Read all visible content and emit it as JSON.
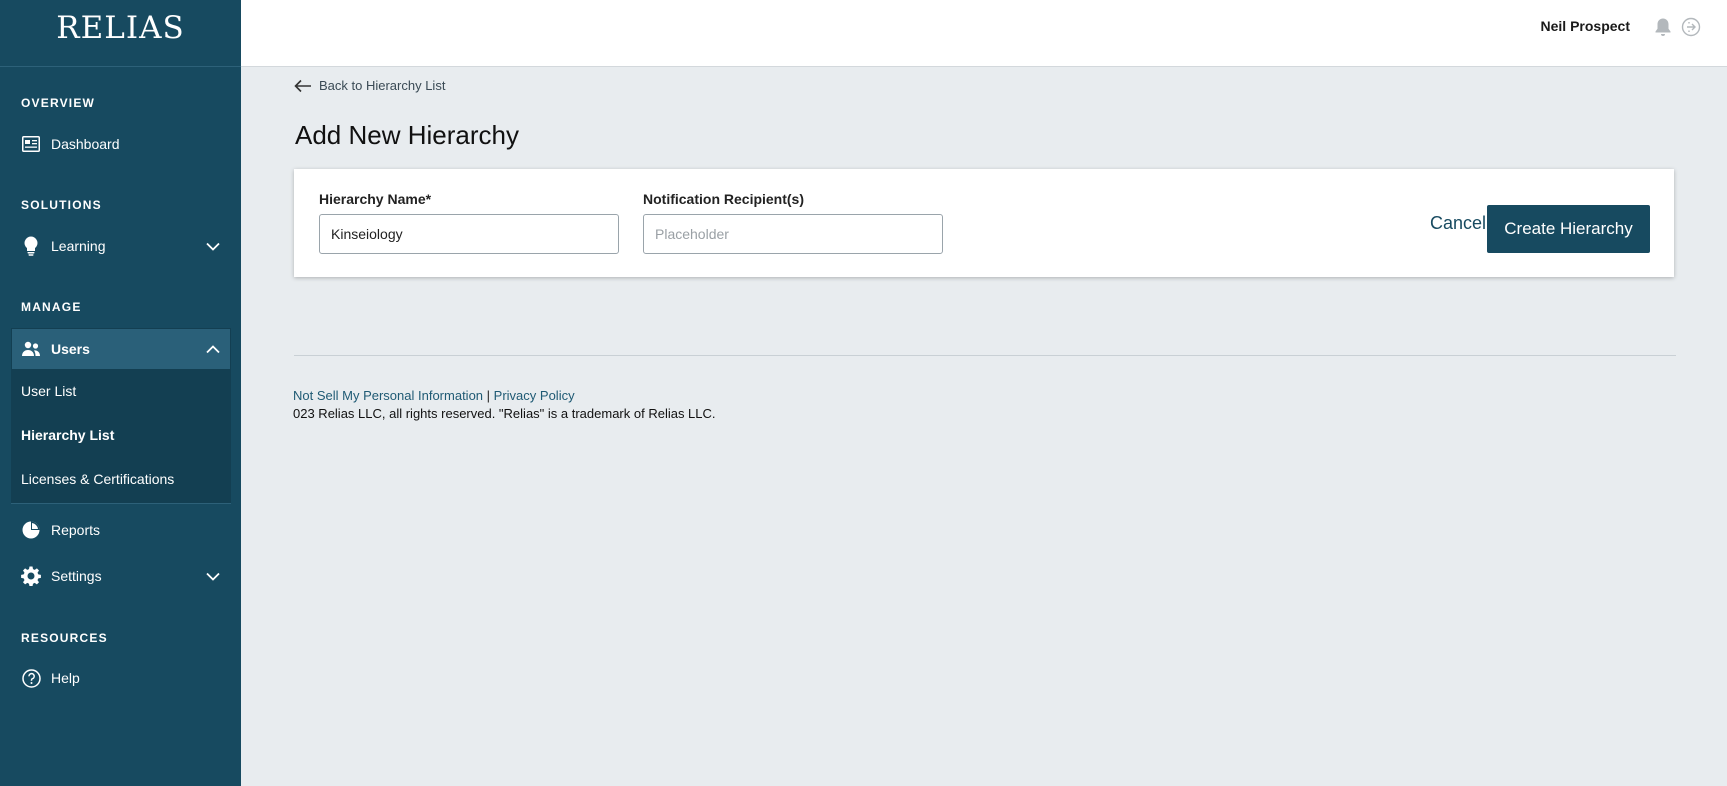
{
  "brand": {
    "logo_text": "RELIAS"
  },
  "header": {
    "user_name": "Neil Prospect",
    "icons": [
      "bell-icon",
      "logout-icon"
    ]
  },
  "sidebar": {
    "sections": {
      "overview": "OVERVIEW",
      "solutions": "SOLUTIONS",
      "manage": "MANAGE",
      "resources": "RESOURCES"
    },
    "items": {
      "dashboard": "Dashboard",
      "learning": "Learning",
      "users": "Users",
      "reports": "Reports",
      "settings": "Settings",
      "help": "Help"
    },
    "users_sub": {
      "user_list": "User List",
      "hierarchy_list": "Hierarchy List",
      "licenses": "Licenses & Certifications"
    },
    "active_item": "Hierarchy List"
  },
  "main": {
    "back_link": "Back to Hierarchy List",
    "title": "Add New Hierarchy",
    "form": {
      "name_label": "Hierarchy Name*",
      "name_value": "Kinseiology",
      "recipients_label": "Notification Recipient(s)",
      "recipients_value": "",
      "recipients_placeholder": "Placeholder",
      "cancel_label": "Cancel",
      "submit_label": "Create Hierarchy"
    }
  },
  "footer": {
    "privacy_link_1": "Not Sell My Personal Information",
    "separator": "|",
    "privacy_link_2": "Privacy Policy",
    "copyright": "023 Relias LLC, all rights reserved. \"Relias\" is a trademark of Relias LLC."
  },
  "colors": {
    "sidebar_bg": "#174a60",
    "primary_button": "#174a60",
    "page_bg": "#e8ecef"
  }
}
